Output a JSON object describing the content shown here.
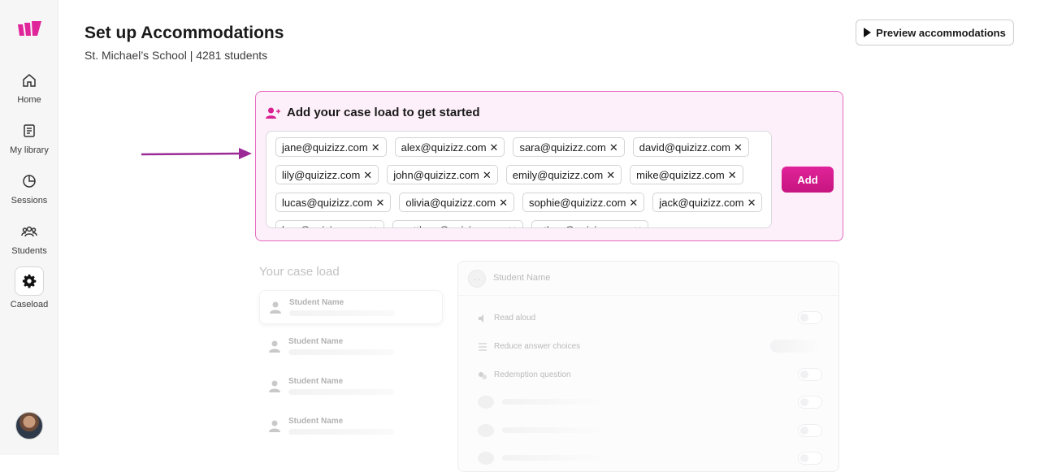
{
  "sidebar": {
    "items": [
      {
        "label": "Home",
        "icon": "home-icon"
      },
      {
        "label": "My library",
        "icon": "library-icon"
      },
      {
        "label": "Sessions",
        "icon": "sessions-icon"
      },
      {
        "label": "Students",
        "icon": "students-icon"
      },
      {
        "label": "Caseload",
        "icon": "gear-icon",
        "active": true
      }
    ]
  },
  "header": {
    "title": "Set up Accommodations",
    "subtitle": "St. Michael’s School | 4281 students",
    "preview_label": "Preview accommodations"
  },
  "add_panel": {
    "title": "Add your case load to get started",
    "add_label": "Add",
    "emails": [
      "jane@quizizz.com",
      "alex@quizizz.com",
      "sara@quizizz.com",
      "david@quizizz.com",
      "lily@quizizz.com",
      "john@quizizz.com",
      "emily@quizizz.com",
      "mike@quizizz.com",
      "lucas@quizizz.com",
      "olivia@quizizz.com",
      "sophie@quizizz.com",
      "jack@quizizz.com",
      "ben@quizizz.com",
      "matthew@quizizz.com",
      "ethan@quizizz.com"
    ]
  },
  "caseload": {
    "title": "Your case load",
    "students": [
      "Student Name",
      "Student Name",
      "Student Name",
      "Student Name"
    ]
  },
  "detail": {
    "avatar_text": ". .",
    "name": "Student Name",
    "options": [
      "Read aloud",
      "Reduce answer choices",
      "Redemption question"
    ]
  },
  "colors": {
    "accent": "#d91f8f",
    "panel_bg": "#fdf0fa",
    "panel_border": "#e56bc0",
    "arrow": "#9b2a96"
  }
}
